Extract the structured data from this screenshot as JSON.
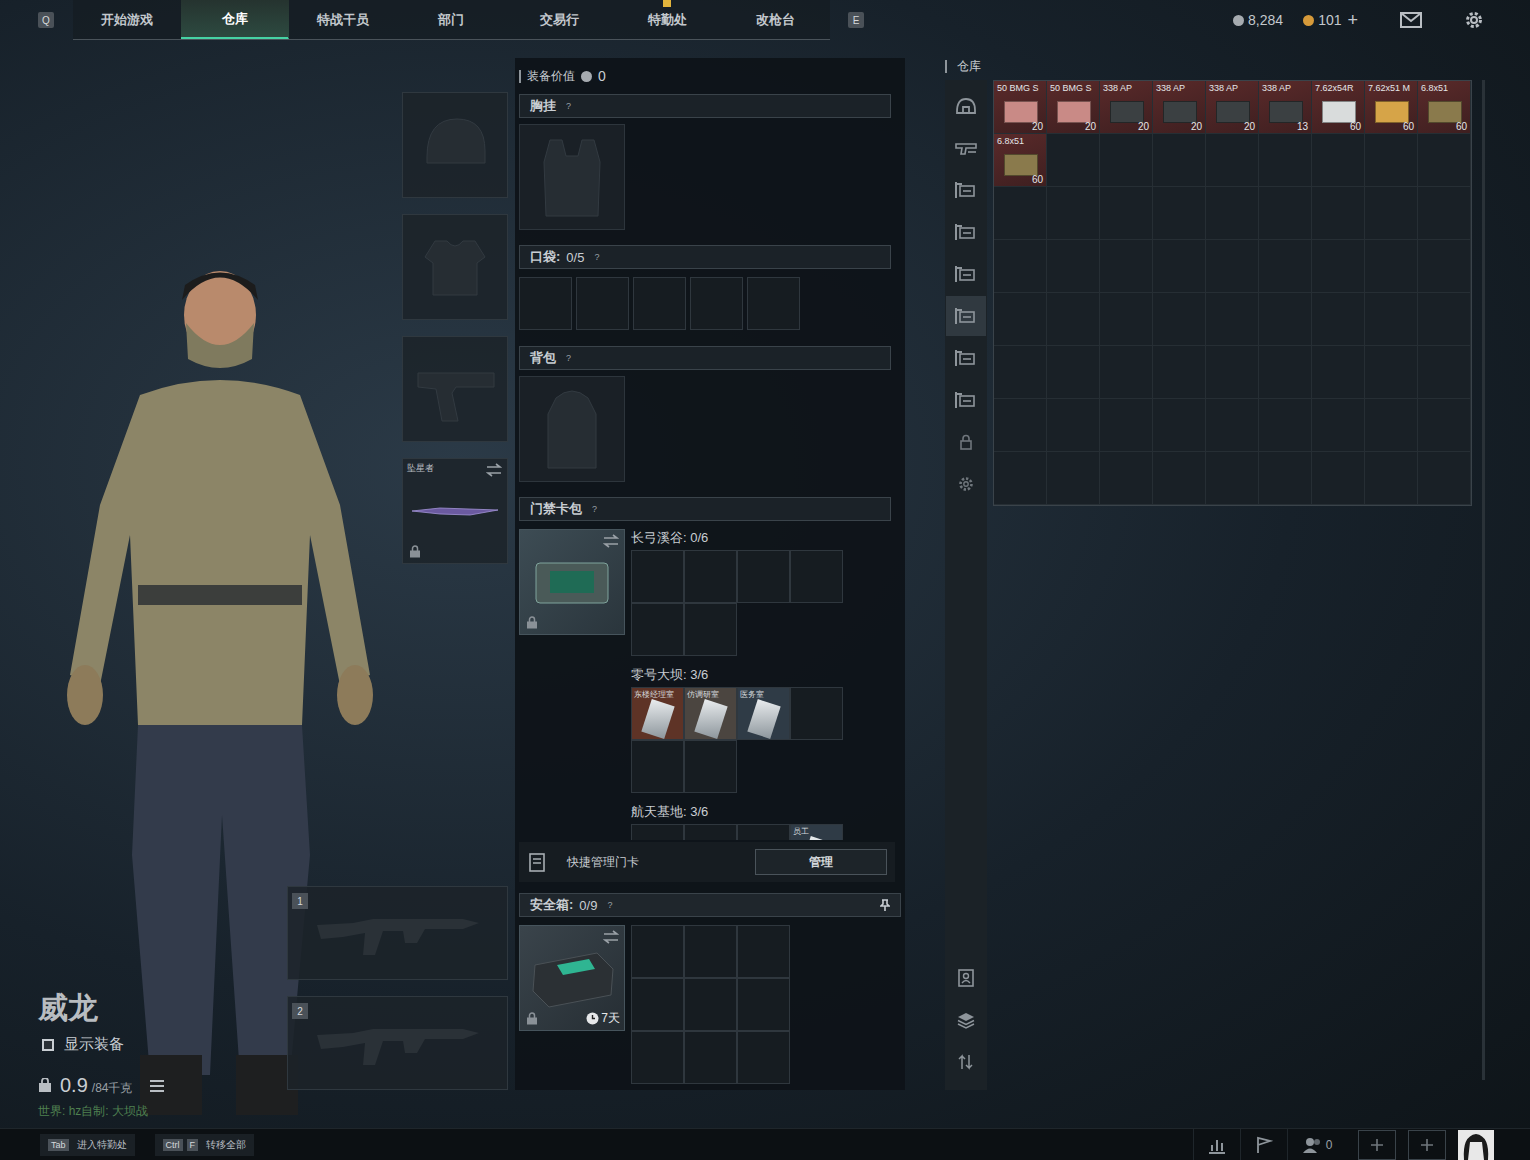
{
  "topbar": {
    "prev_key": "Q",
    "next_key": "E",
    "tabs": [
      {
        "label": "开始游戏",
        "selected": false,
        "alert": false
      },
      {
        "label": "仓库",
        "selected": true,
        "alert": false
      },
      {
        "label": "特战干员",
        "selected": false,
        "alert": false
      },
      {
        "label": "部门",
        "selected": false,
        "alert": false
      },
      {
        "label": "交易行",
        "selected": false,
        "alert": false
      },
      {
        "label": "特勤处",
        "selected": false,
        "alert": true
      },
      {
        "label": "改枪台",
        "selected": false,
        "alert": false
      }
    ],
    "currencies": [
      {
        "amount": "8,284",
        "color": "#a6abb0"
      },
      {
        "amount": "101",
        "color": "#d69a3a"
      }
    ],
    "add": "+"
  },
  "character": {
    "name": "威龙",
    "show_gear": {
      "label": "显示装备",
      "checked": false
    },
    "weight": "0.9",
    "weight_max": "/84千克",
    "location": "世界: hz自制: 大坝战"
  },
  "gear_slots": [
    {
      "kind": "helmet",
      "label": "",
      "locked": false
    },
    {
      "kind": "armor",
      "label": "",
      "locked": false
    },
    {
      "kind": "pistol",
      "label": "",
      "locked": false
    },
    {
      "kind": "melee",
      "label": "坠星者",
      "locked": true
    }
  ],
  "weapon_slots": [
    {
      "number": "1"
    },
    {
      "number": "2"
    }
  ],
  "loadout": {
    "value_label": "装备价值",
    "value": "0",
    "chest": {
      "title": "胸挂",
      "help": "?"
    },
    "pockets": {
      "title": "口袋:",
      "count": "0/5",
      "help": "?",
      "slots": [
        {
          "filled": false
        },
        {
          "filled": false
        },
        {
          "filled": false
        },
        {
          "filled": false
        },
        {
          "filled": false
        }
      ]
    },
    "backpack": {
      "title": "背包",
      "help": "?"
    },
    "keycard": {
      "title": "门禁卡包",
      "help": "?",
      "locked": true,
      "maps": [
        {
          "name": "长弓溪谷:",
          "count": "0/6",
          "cells": [
            {
              "filled": false,
              "label": "",
              "color": ""
            },
            {
              "filled": false,
              "label": "",
              "color": ""
            },
            {
              "filled": false,
              "label": "",
              "color": ""
            },
            {
              "filled": false,
              "label": "",
              "color": ""
            },
            {
              "filled": false,
              "label": "",
              "color": ""
            },
            {
              "filled": false,
              "label": "",
              "color": ""
            }
          ]
        },
        {
          "name": "零号大坝:",
          "count": "3/6",
          "cells": [
            {
              "filled": true,
              "label": "东楼经理室",
              "color": "#5e3326"
            },
            {
              "filled": true,
              "label": "仿调研室",
              "color": "#4b4540"
            },
            {
              "filled": true,
              "label": "医务室",
              "color": "#2f3b46"
            },
            {
              "filled": false,
              "label": "",
              "color": ""
            },
            {
              "filled": false,
              "label": "",
              "color": ""
            },
            {
              "filled": false,
              "label": "",
              "color": ""
            }
          ]
        },
        {
          "name": "航天基地:",
          "count": "3/6",
          "cells": [
            {
              "filled": false,
              "label": "",
              "color": ""
            },
            {
              "filled": false,
              "label": "",
              "color": ""
            },
            {
              "filled": false,
              "label": "",
              "color": ""
            },
            {
              "filled": true,
              "label": "员工",
              "color": "#2f3b46"
            },
            {
              "filled": false,
              "label": "",
              "color": ""
            },
            {
              "filled": false,
              "label": "",
              "color": ""
            }
          ]
        }
      ]
    },
    "quick_manage": {
      "label": "快捷管理门卡",
      "button": "管理"
    },
    "safe": {
      "title": "安全箱:",
      "count": "0/9",
      "help": "?",
      "timer": "7天",
      "locked": true,
      "cells": [
        {
          "filled": false
        },
        {
          "filled": false
        },
        {
          "filled": false
        },
        {
          "filled": false
        },
        {
          "filled": false
        },
        {
          "filled": false
        },
        {
          "filled": false
        },
        {
          "filled": false
        },
        {
          "filled": false
        }
      ]
    }
  },
  "warehouse": {
    "title": "仓库",
    "sidebar": [
      {
        "kind": "helmet",
        "selected": false
      },
      {
        "kind": "gun",
        "selected": false
      },
      {
        "kind": "rack",
        "selected": false
      },
      {
        "kind": "rack",
        "selected": false
      },
      {
        "kind": "rack",
        "selected": false
      },
      {
        "kind": "rack",
        "selected": true
      },
      {
        "kind": "rack",
        "selected": false
      },
      {
        "kind": "rack",
        "selected": false
      },
      {
        "kind": "lock",
        "selected": false
      },
      {
        "kind": "gear",
        "selected": false
      }
    ],
    "tools": [
      {
        "kind": "member"
      },
      {
        "kind": "layers"
      },
      {
        "kind": "sort"
      }
    ],
    "items": [
      {
        "name": "50 BMG S",
        "count": "20",
        "color": "#c98a86"
      },
      {
        "name": "50 BMG S",
        "count": "20",
        "color": "#c98a86"
      },
      {
        "name": "338 AP",
        "count": "20",
        "color": "#3b4042"
      },
      {
        "name": "338 AP",
        "count": "20",
        "color": "#3b4042"
      },
      {
        "name": "338 AP",
        "count": "20",
        "color": "#3b4042"
      },
      {
        "name": "338 AP",
        "count": "13",
        "color": "#3b4042"
      },
      {
        "name": "7.62x54R",
        "count": "60",
        "color": "#d9dcdc"
      },
      {
        "name": "7.62x51 M",
        "count": "60",
        "color": "#d6a448"
      },
      {
        "name": "6.8x51",
        "count": "60",
        "color": "#8a7a4c"
      },
      {
        "name": "6.8x51",
        "count": "60",
        "color": "#8a7a4c"
      }
    ]
  },
  "bottombar": {
    "hints": [
      {
        "keys": [
          "Tab"
        ],
        "label": "进入特勤处"
      },
      {
        "keys": [
          "Ctrl",
          "F"
        ],
        "label": "转移全部"
      }
    ],
    "friends": "0"
  }
}
